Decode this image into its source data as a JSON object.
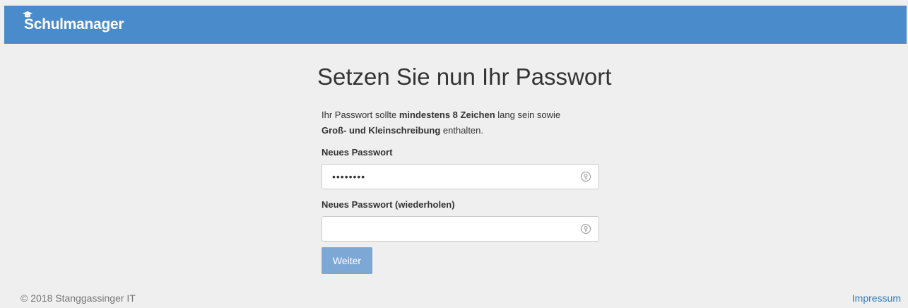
{
  "app": {
    "brand": "Schulmanager"
  },
  "page": {
    "title": "Setzen Sie nun Ihr Passwort",
    "intro_part1": "Ihr Passwort sollte ",
    "intro_bold1": "mindestens 8 Zeichen",
    "intro_part2": " lang sein sowie ",
    "intro_bold2": "Groß- und Kleinschreibung",
    "intro_part3": " enthalten."
  },
  "form": {
    "new_password_label": "Neues Passwort",
    "new_password_value": "••••••••",
    "repeat_password_label": "Neues Passwort (wiederholen)",
    "repeat_password_value": "",
    "submit_label": "Weiter"
  },
  "footer": {
    "copyright": "© 2018 Stanggassinger IT",
    "impressum": "Impressum"
  },
  "colors": {
    "navbar": "#4a8ccb",
    "button": "#7da7d4",
    "link": "#337ab7"
  },
  "icons": {
    "brand": "graduation-cap-icon",
    "password_field": "key-icon"
  }
}
